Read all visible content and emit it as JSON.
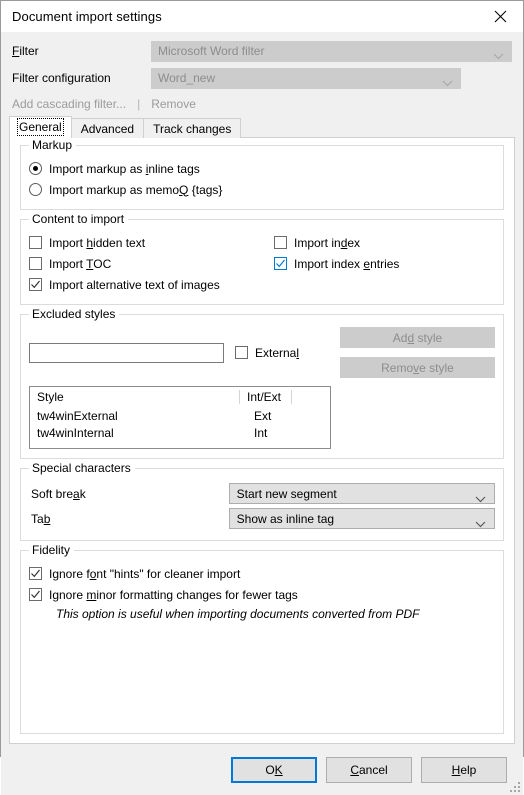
{
  "window": {
    "title": "Document import settings",
    "close_icon": "close-icon"
  },
  "top": {
    "filter_label": "Filter",
    "filter_value": "Microsoft Word filter",
    "filter_config_label": "Filter configuration",
    "filter_config_value": "Word_new",
    "add_cascading_filter": "Add cascading filter...",
    "separator": "|",
    "remove": "Remove"
  },
  "tabs": [
    {
      "label": "General",
      "active": true
    },
    {
      "label": "Advanced",
      "active": false
    },
    {
      "label": "Track changes",
      "active": false
    }
  ],
  "markup": {
    "legend": "Markup",
    "options": [
      {
        "label_pre": "Import markup as ",
        "mnemonic": "i",
        "label_post": "nline tags",
        "selected": true
      },
      {
        "label_pre": "Import markup as memo",
        "mnemonic": "Q",
        "label_post": " {tags}",
        "selected": false
      }
    ]
  },
  "content": {
    "legend": "Content to import",
    "left": [
      {
        "label_pre": "Import ",
        "mnemonic": "h",
        "label_post": "idden text",
        "checked": false,
        "focus": false
      },
      {
        "label_pre": "Import ",
        "mnemonic": "T",
        "label_post": "OC",
        "checked": false,
        "focus": false
      },
      {
        "label_pre": "Import alternative text of images",
        "mnemonic": "",
        "label_post": "",
        "checked": true,
        "focus": false
      }
    ],
    "right": [
      {
        "label_pre": "Import in",
        "mnemonic": "d",
        "label_post": "ex",
        "checked": false,
        "focus": false
      },
      {
        "label_pre": "Import index ",
        "mnemonic": "e",
        "label_post": "ntries",
        "checked": true,
        "focus": true
      }
    ]
  },
  "excluded": {
    "legend": "Excluded styles",
    "input_value": "",
    "input_placeholder": "",
    "external": {
      "label_pre": "Externa",
      "mnemonic": "l",
      "label_post": "",
      "checked": false
    },
    "add_style": {
      "label_pre": "Ad",
      "mnemonic": "d",
      "label_post": " style",
      "disabled": true
    },
    "remove_style": {
      "label_pre": "Remo",
      "mnemonic": "v",
      "label_post": "e style",
      "disabled": true
    },
    "columns": [
      "Style",
      "Int/Ext"
    ],
    "rows": [
      {
        "style": "tw4winExternal",
        "intext": "Ext"
      },
      {
        "style": "tw4winInternal",
        "intext": "Int"
      }
    ]
  },
  "special": {
    "legend": "Special characters",
    "rows": [
      {
        "label_pre": "Soft bre",
        "mnemonic": "a",
        "label_post": "k",
        "value": "Start new segment"
      },
      {
        "label_pre": "Ta",
        "mnemonic": "b",
        "label_post": "",
        "value": "Show as inline tag"
      }
    ]
  },
  "fidelity": {
    "legend": "Fidelity",
    "options": [
      {
        "label_pre": "Ignore f",
        "mnemonic": "o",
        "label_post": "nt \"hints\" for cleaner import",
        "checked": true
      },
      {
        "label_pre": "Ignore ",
        "mnemonic": "m",
        "label_post": "inor formatting changes for fewer tags",
        "checked": true
      }
    ],
    "hint": "This option is useful when importing documents converted from PDF"
  },
  "footer": {
    "ok": {
      "label_pre": "O",
      "mnemonic": "K",
      "label_post": "",
      "default": true
    },
    "cancel": {
      "label_pre": "",
      "mnemonic": "C",
      "label_post": "ancel",
      "default": false
    },
    "help": {
      "label_pre": "",
      "mnemonic": "H",
      "label_post": "elp",
      "default": false
    }
  },
  "colors": {
    "accent": "#0078d7",
    "dialog_bg": "#f0f0f0",
    "panel_bg": "#ffffff",
    "disabled_bg": "#cccccc",
    "disabled_text": "#8d8d8d",
    "combo_bg": "#e1e1e1"
  }
}
